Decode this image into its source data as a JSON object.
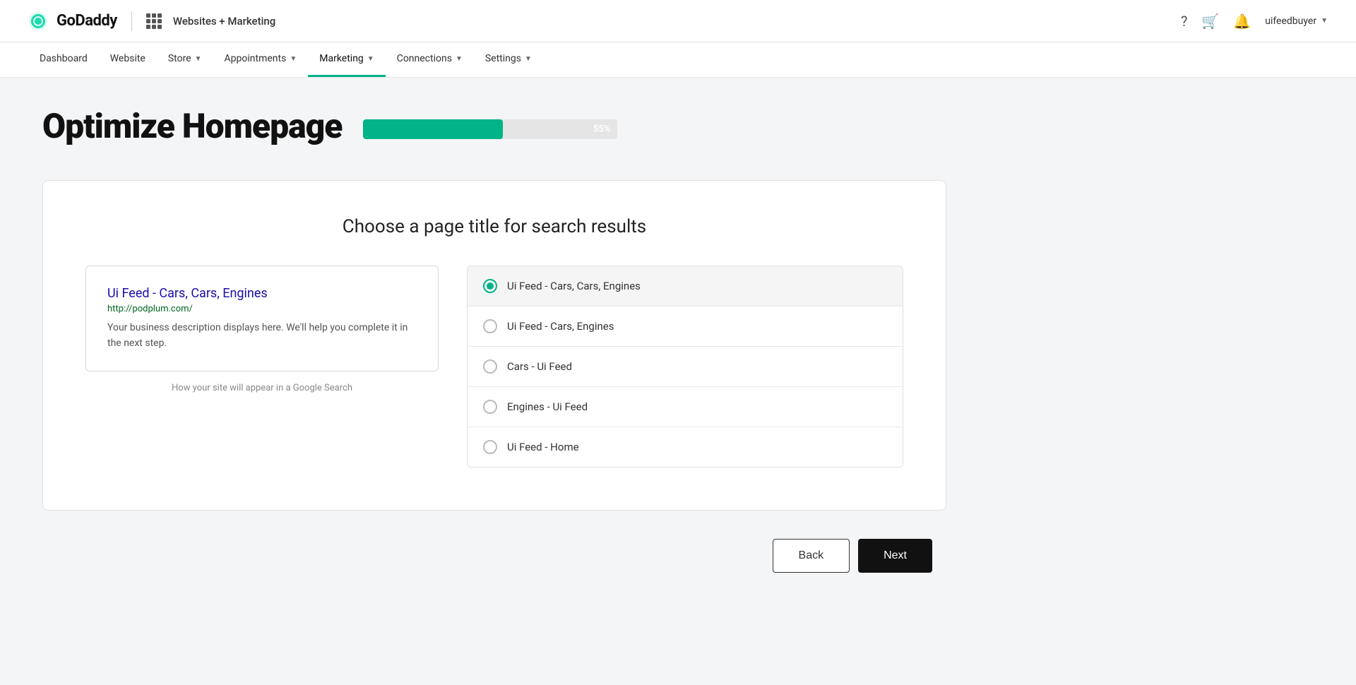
{
  "header": {
    "logo_text": "GoDaddy",
    "brand_name": "Websites + Marketing",
    "user_name": "uifeedbuyer"
  },
  "nav": {
    "items": [
      {
        "id": "dashboard",
        "label": "Dashboard",
        "has_chevron": false,
        "active": false
      },
      {
        "id": "website",
        "label": "Website",
        "has_chevron": false,
        "active": false
      },
      {
        "id": "store",
        "label": "Store",
        "has_chevron": true,
        "active": false
      },
      {
        "id": "appointments",
        "label": "Appointments",
        "has_chevron": true,
        "active": false
      },
      {
        "id": "marketing",
        "label": "Marketing",
        "has_chevron": true,
        "active": true
      },
      {
        "id": "connections",
        "label": "Connections",
        "has_chevron": true,
        "active": false
      },
      {
        "id": "settings",
        "label": "Settings",
        "has_chevron": true,
        "active": false
      }
    ]
  },
  "page": {
    "title": "Optimize Homepage",
    "progress_percent": 55,
    "progress_label": "55%",
    "progress_width": "55%"
  },
  "card": {
    "title": "Choose a page title for search results",
    "google_preview": {
      "site_title": "Ui Feed - Cars, Cars, Engines",
      "site_url": "http://podplum.com/",
      "site_desc": "Your business description displays here. We'll help you complete it in the next step.",
      "caption": "How your site will appear in a Google Search"
    },
    "options": [
      {
        "id": "opt1",
        "label": "Ui Feed - Cars, Cars, Engines",
        "selected": true
      },
      {
        "id": "opt2",
        "label": "Ui Feed - Cars, Engines",
        "selected": false
      },
      {
        "id": "opt3",
        "label": "Cars - Ui Feed",
        "selected": false
      },
      {
        "id": "opt4",
        "label": "Engines - Ui Feed",
        "selected": false
      },
      {
        "id": "opt5",
        "label": "Ui Feed - Home",
        "selected": false
      }
    ]
  },
  "buttons": {
    "back_label": "Back",
    "next_label": "Next"
  }
}
